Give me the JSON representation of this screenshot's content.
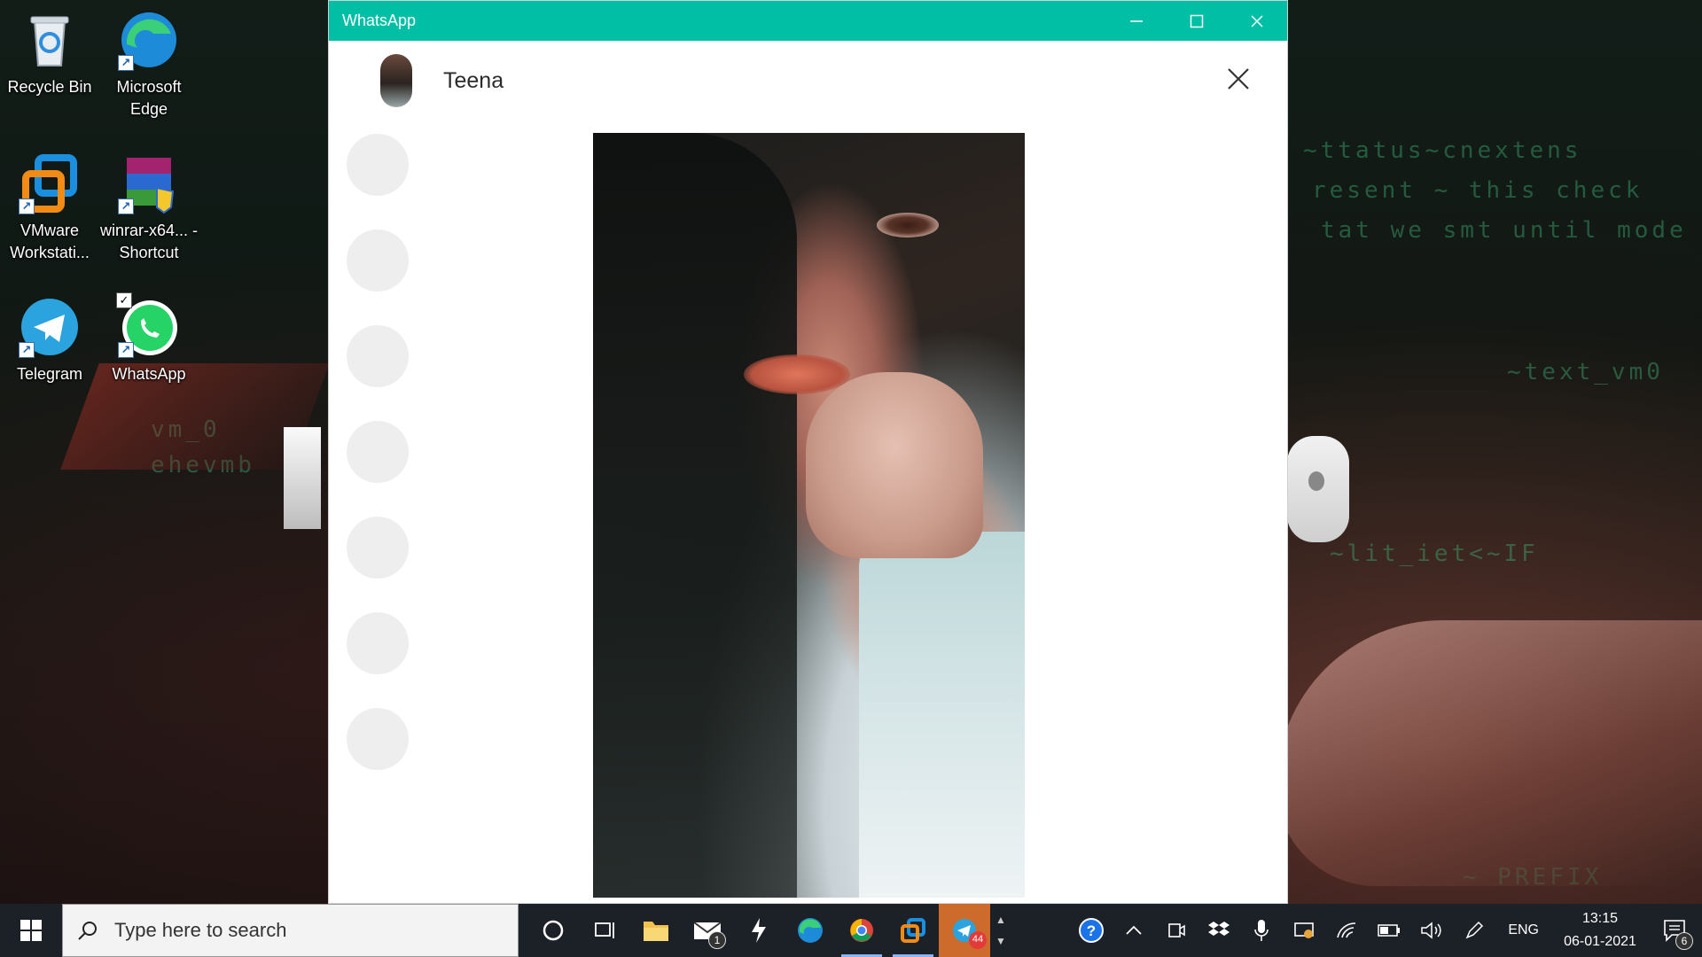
{
  "desktop": {
    "icons": [
      {
        "label": "Recycle Bin"
      },
      {
        "label": "Microsoft Edge"
      },
      {
        "label": "VMware Workstati..."
      },
      {
        "label": "winrar-x64... - Shortcut"
      },
      {
        "label": "Telegram"
      },
      {
        "label": "WhatsApp"
      }
    ]
  },
  "window": {
    "title": "WhatsApp",
    "minimize_icon": "minimize-icon",
    "maximize_icon": "maximize-icon",
    "close_icon": "close-icon",
    "contact_name": "Teena",
    "viewer_close_icon": "close-icon"
  },
  "taskbar": {
    "search_placeholder": "Type here to search",
    "mail_badge": "1",
    "telegram_badge": "44",
    "language": "ENG",
    "time": "13:15",
    "date": "06-01-2021",
    "notification_count": "6"
  },
  "colors": {
    "whatsapp_teal": "#00bfa5",
    "taskbar_bg": "#1c2027"
  }
}
